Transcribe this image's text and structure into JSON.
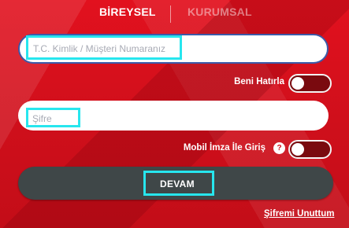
{
  "tabs": {
    "individual": "BİREYSEL",
    "corporate": "KURUMSAL"
  },
  "fields": {
    "id_placeholder": "T.C. Kimlik / Müşteri Numaranız",
    "password_placeholder": "Şifre"
  },
  "options": {
    "remember_me": {
      "label": "Beni Hatırla",
      "on": false
    },
    "mobile_signature": {
      "label": "Mobil İmza İle Giriş",
      "help": "?",
      "on": false
    }
  },
  "actions": {
    "continue_label": "DEVAM",
    "forgot_password": "Şifremi Unuttum"
  },
  "colors": {
    "background": "#d4121f",
    "button": "#3f4748",
    "highlight": "#27e6ee",
    "toggle_track": "#7a0a0f",
    "input_border": "#3c5aa8"
  }
}
